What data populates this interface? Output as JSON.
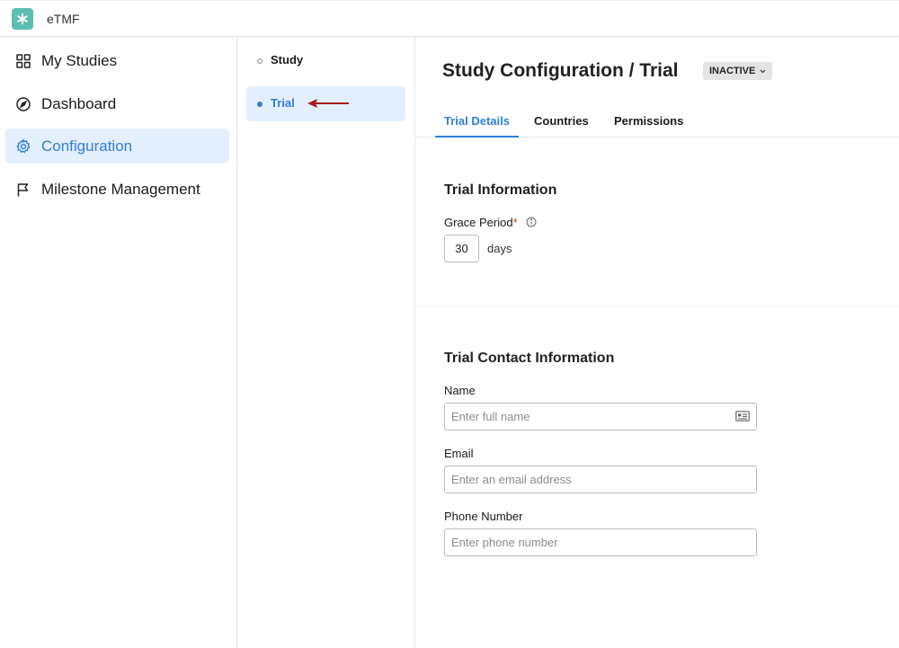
{
  "app": {
    "name": "eTMF",
    "accent": "#2f7fd8",
    "logo_color": "#5bbfb2"
  },
  "sidebar": {
    "items": [
      {
        "label": "My Studies",
        "icon": "grid-icon",
        "active": false
      },
      {
        "label": "Dashboard",
        "icon": "compass-icon",
        "active": false
      },
      {
        "label": "Configuration",
        "icon": "gear-icon",
        "active": true
      },
      {
        "label": "Milestone Management",
        "icon": "flag-icon",
        "active": false
      }
    ]
  },
  "subnav": {
    "items": [
      {
        "label": "Study",
        "active": false
      },
      {
        "label": "Trial",
        "active": true
      }
    ]
  },
  "header": {
    "title": "Study Configuration / Trial",
    "status": "INACTIVE"
  },
  "tabs": [
    {
      "label": "Trial Details",
      "active": true
    },
    {
      "label": "Countries",
      "active": false
    },
    {
      "label": "Permissions",
      "active": false
    }
  ],
  "trial_information": {
    "title": "Trial Information",
    "grace_period_label": "Grace Period",
    "required_mark": "*",
    "grace_period_value": "30",
    "grace_period_unit": "days"
  },
  "contact": {
    "title": "Trial Contact Information",
    "name_label": "Name",
    "name_placeholder": "Enter full name",
    "name_value": "",
    "email_label": "Email",
    "email_placeholder": "Enter an email address",
    "email_value": "",
    "phone_label": "Phone Number",
    "phone_placeholder": "Enter phone number",
    "phone_value": ""
  }
}
